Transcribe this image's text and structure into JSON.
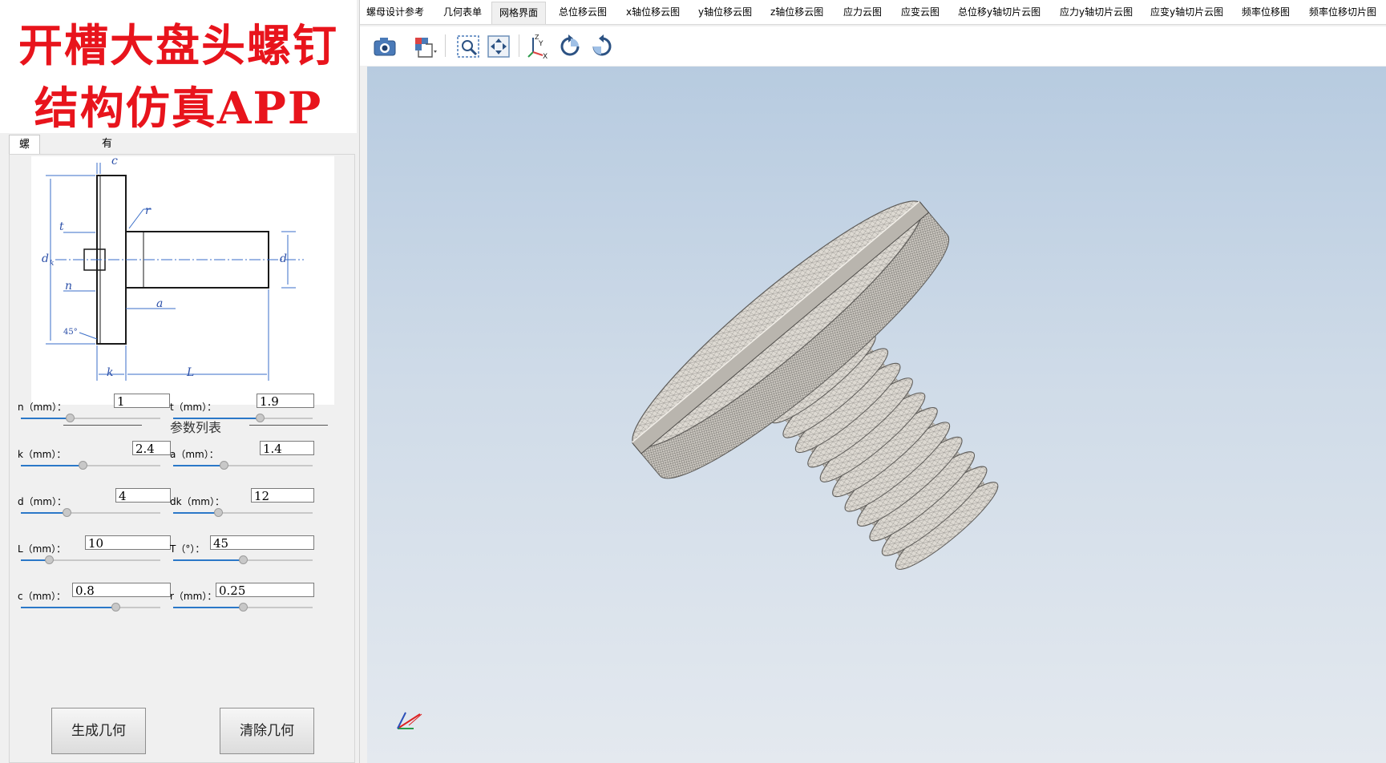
{
  "banner": {
    "line1": "开槽大盘头螺钉",
    "line2": "结构仿真APP"
  },
  "param_tabs": [
    {
      "label": "螺母几何参数",
      "active": true
    },
    {
      "label": "有限元参数",
      "active": false
    }
  ],
  "drawing": {
    "labels": {
      "c": "c",
      "r": "r",
      "t": "t",
      "dk": "d",
      "dk_sub": "k",
      "d": "d",
      "n": "n",
      "a": "a",
      "angle": "45°",
      "k": "k",
      "L": "L"
    }
  },
  "param_list_title": "参数列表",
  "params": [
    {
      "label": "n（mm）：",
      "value": "1",
      "level": 0.35
    },
    {
      "label": "t（mm）：",
      "value": "1.9",
      "level": 0.62
    },
    {
      "label": "k（mm）：",
      "value": "2.4",
      "level": 0.44
    },
    {
      "label": "a（mm）：",
      "value": "1.4",
      "level": 0.36
    },
    {
      "label": "d（mm）：",
      "value": "4",
      "level": 0.33
    },
    {
      "label": "dk（mm）：",
      "value": "12",
      "level": 0.32
    },
    {
      "label": "L（mm）：",
      "value": "10",
      "level": 0.2
    },
    {
      "label": "T（°）：",
      "value": "45",
      "level": 0.5
    },
    {
      "label": "c（mm）：",
      "value": "0.8",
      "level": 0.68
    },
    {
      "label": "r（mm）：",
      "value": "0.25",
      "level": 0.5
    }
  ],
  "buttons": {
    "generate": "生成几何",
    "clear": "清除几何"
  },
  "menu": [
    {
      "label": "螺母设计参考",
      "active": false
    },
    {
      "label": "几何表单",
      "active": false
    },
    {
      "label": "网格界面",
      "active": true
    },
    {
      "label": "总位移云图",
      "active": false
    },
    {
      "label": "x轴位移云图",
      "active": false
    },
    {
      "label": "y轴位移云图",
      "active": false
    },
    {
      "label": "z轴位移云图",
      "active": false
    },
    {
      "label": "应力云图",
      "active": false
    },
    {
      "label": "应变云图",
      "active": false
    },
    {
      "label": "总位移y轴切片云图",
      "active": false
    },
    {
      "label": "应力y轴切片云图",
      "active": false
    },
    {
      "label": "应变y轴切片云图",
      "active": false
    },
    {
      "label": "频率位移图",
      "active": false
    },
    {
      "label": "频率位移切片图",
      "active": false
    }
  ],
  "toolbar": [
    "camera-icon",
    "view-cube-icon",
    "zoom-fit-icon",
    "pan-icon",
    "axes-icon",
    "rotate-ccw-icon",
    "rotate-cw-icon"
  ],
  "colors": {
    "banner_text": "#e8141c",
    "slider_fill": "#2b78c8",
    "viewport_top": "#b7cbe0",
    "viewport_bottom": "#e4e9ef",
    "mesh": "#d9d5ce"
  }
}
